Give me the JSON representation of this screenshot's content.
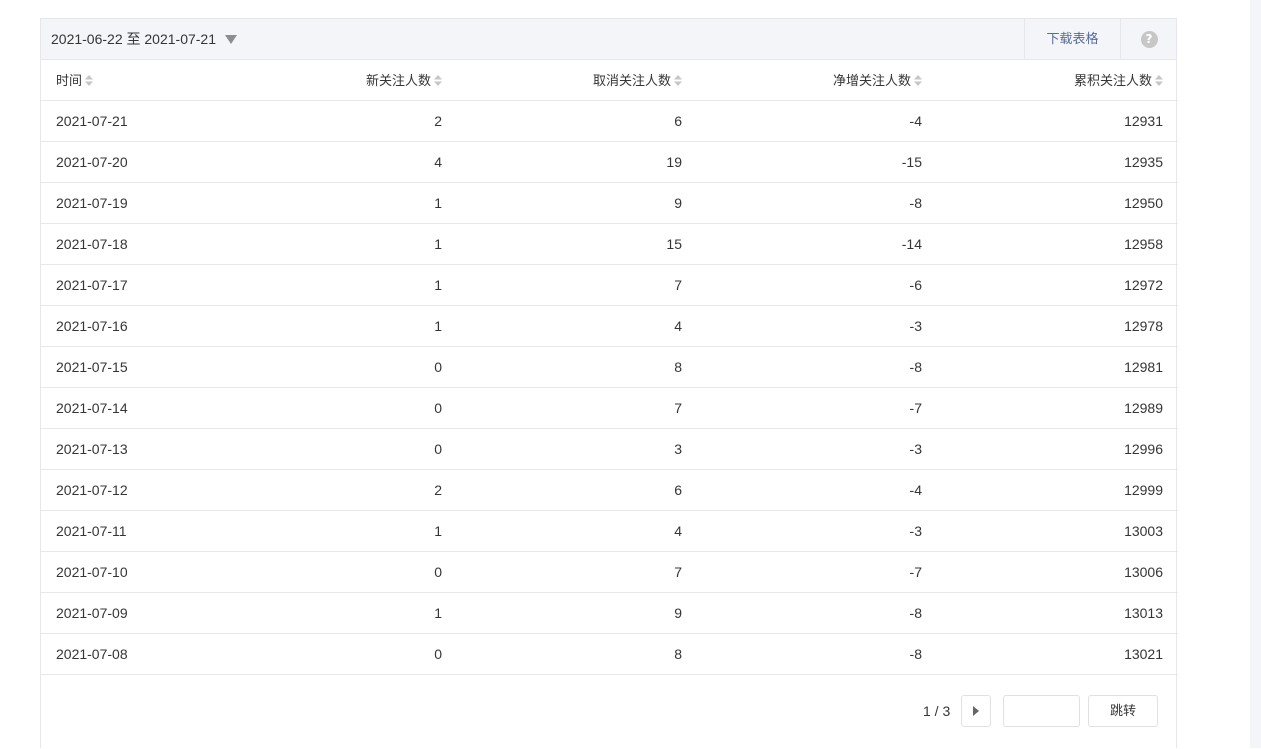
{
  "toolbar": {
    "date_range": "2021-06-22 至 2021-07-21",
    "download_label": "下载表格",
    "help_label": "?"
  },
  "table": {
    "headers": [
      "时间",
      "新关注人数",
      "取消关注人数",
      "净增关注人数",
      "累积关注人数"
    ],
    "rows": [
      [
        "2021-07-21",
        "2",
        "6",
        "-4",
        "12931"
      ],
      [
        "2021-07-20",
        "4",
        "19",
        "-15",
        "12935"
      ],
      [
        "2021-07-19",
        "1",
        "9",
        "-8",
        "12950"
      ],
      [
        "2021-07-18",
        "1",
        "15",
        "-14",
        "12958"
      ],
      [
        "2021-07-17",
        "1",
        "7",
        "-6",
        "12972"
      ],
      [
        "2021-07-16",
        "1",
        "4",
        "-3",
        "12978"
      ],
      [
        "2021-07-15",
        "0",
        "8",
        "-8",
        "12981"
      ],
      [
        "2021-07-14",
        "0",
        "7",
        "-7",
        "12989"
      ],
      [
        "2021-07-13",
        "0",
        "3",
        "-3",
        "12996"
      ],
      [
        "2021-07-12",
        "2",
        "6",
        "-4",
        "12999"
      ],
      [
        "2021-07-11",
        "1",
        "4",
        "-3",
        "13003"
      ],
      [
        "2021-07-10",
        "0",
        "7",
        "-7",
        "13006"
      ],
      [
        "2021-07-09",
        "1",
        "9",
        "-8",
        "13013"
      ],
      [
        "2021-07-08",
        "0",
        "8",
        "-8",
        "13021"
      ]
    ]
  },
  "pager": {
    "page_info": "1 / 3",
    "input_value": "",
    "jump_label": "跳转"
  },
  "colors": {
    "link": "#576b95",
    "border": "#e7e7eb",
    "toolbar_bg": "#f4f5f9"
  },
  "icons": {
    "sort": "sort-icon",
    "dropdown": "caret-down-icon",
    "help": "help-icon",
    "next": "next-page-icon"
  }
}
